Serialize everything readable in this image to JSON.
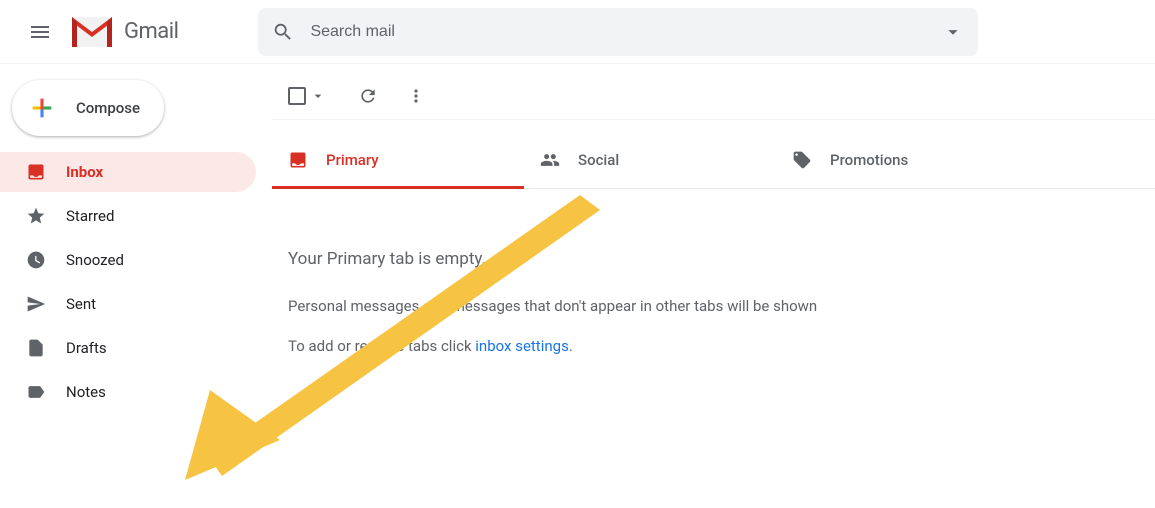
{
  "header": {
    "app_name": "Gmail",
    "search_placeholder": "Search mail"
  },
  "sidebar": {
    "compose_label": "Compose",
    "items": [
      {
        "label": "Inbox",
        "icon": "inbox",
        "active": true
      },
      {
        "label": "Starred",
        "icon": "star",
        "active": false
      },
      {
        "label": "Snoozed",
        "icon": "clock",
        "active": false
      },
      {
        "label": "Sent",
        "icon": "send",
        "active": false
      },
      {
        "label": "Drafts",
        "icon": "file",
        "active": false
      },
      {
        "label": "Notes",
        "icon": "label",
        "active": false
      }
    ]
  },
  "tabs": [
    {
      "label": "Primary",
      "icon": "inbox",
      "active": true
    },
    {
      "label": "Social",
      "icon": "people",
      "active": false
    },
    {
      "label": "Promotions",
      "icon": "tag",
      "active": false
    }
  ],
  "empty": {
    "title": "Your Primary tab is empty.",
    "line1": "Personal messages and messages that don't appear in other tabs will be shown",
    "line2_prefix": "To add or remove tabs click ",
    "line2_link": "inbox settings",
    "line2_suffix": "."
  },
  "annotation": {
    "arrow_color": "#f7c342"
  }
}
